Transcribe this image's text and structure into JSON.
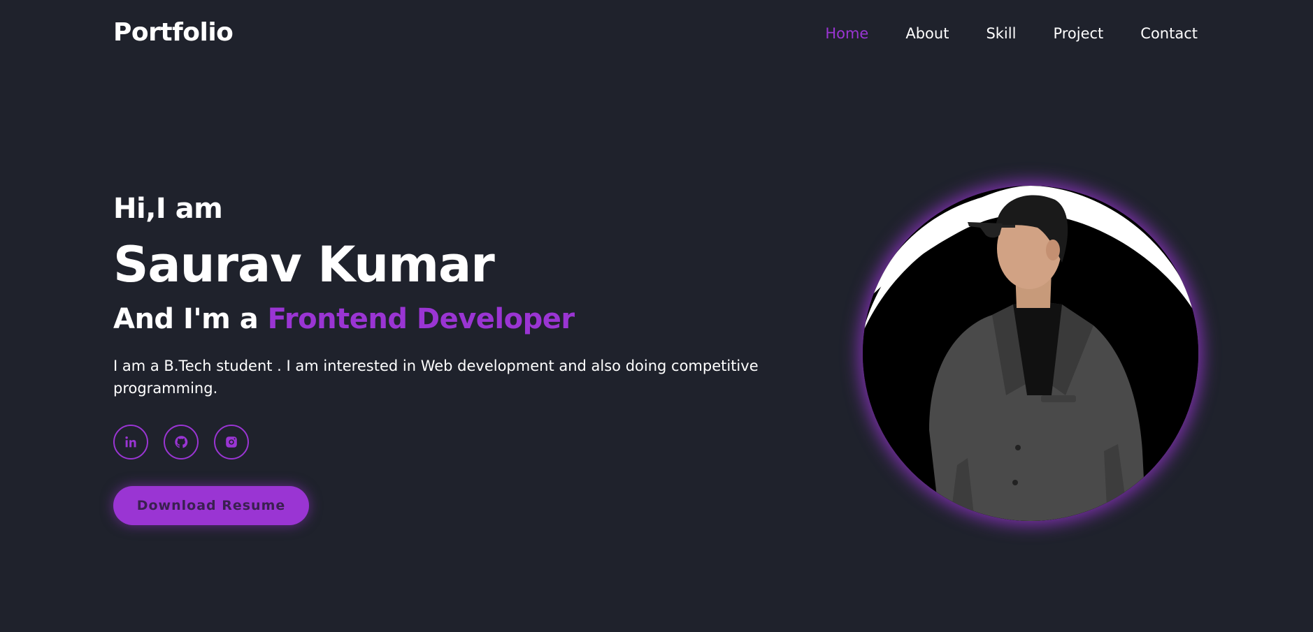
{
  "header": {
    "logo": "Portfolio",
    "nav": [
      {
        "label": "Home",
        "active": true
      },
      {
        "label": "About",
        "active": false
      },
      {
        "label": "Skill",
        "active": false
      },
      {
        "label": "Project",
        "active": false
      },
      {
        "label": "Contact",
        "active": false
      }
    ]
  },
  "hero": {
    "greeting": "Hi,I am",
    "name": "Saurav Kumar",
    "role_prefix": "And I'm a ",
    "role_highlight": "Frontend Developer",
    "description": "I am a B.Tech student . I am interested in Web development and also doing competitive programming.",
    "socials": [
      {
        "icon": "linkedin-icon"
      },
      {
        "icon": "github-icon"
      },
      {
        "icon": "instagram-icon"
      }
    ],
    "download_label": "Download Resume",
    "profile_image": "profile-photo"
  },
  "colors": {
    "background": "#1f222c",
    "accent": "#9a35d3",
    "text": "#ffffff"
  }
}
